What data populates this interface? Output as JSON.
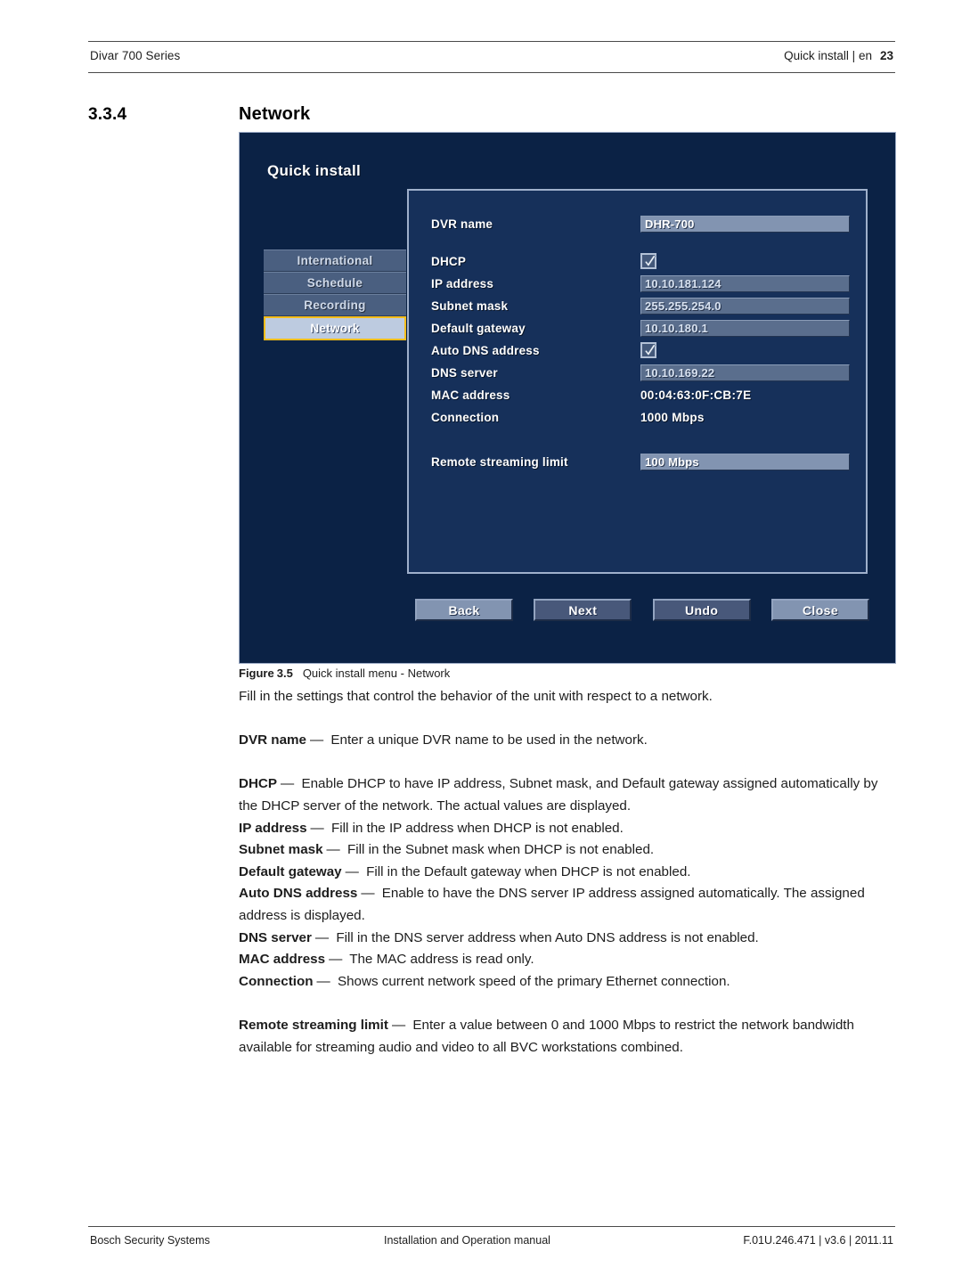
{
  "header": {
    "left": "Divar 700 Series",
    "right": "Quick install | en",
    "page_number": "23"
  },
  "section": {
    "number": "3.3.4",
    "title": "Network"
  },
  "screenshot": {
    "title": "Quick install",
    "nav": [
      {
        "label": "International",
        "selected": false
      },
      {
        "label": "Schedule",
        "selected": false
      },
      {
        "label": "Recording",
        "selected": false
      },
      {
        "label": "Network",
        "selected": true
      }
    ],
    "fields": [
      {
        "label": "DVR name",
        "value": "DHR-700",
        "type": "field-active"
      },
      {
        "label": "DHCP",
        "value": "checked",
        "type": "checkbox"
      },
      {
        "label": "IP address",
        "value": "10.10.181.124",
        "type": "field"
      },
      {
        "label": "Subnet mask",
        "value": "255.255.254.0",
        "type": "field"
      },
      {
        "label": "Default gateway",
        "value": "10.10.180.1",
        "type": "field"
      },
      {
        "label": "Auto DNS address",
        "value": "checked",
        "type": "checkbox"
      },
      {
        "label": "DNS server",
        "value": "10.10.169.22",
        "type": "field"
      },
      {
        "label": "MAC address",
        "value": "00:04:63:0F:CB:7E",
        "type": "text"
      },
      {
        "label": "Connection",
        "value": "1000 Mbps",
        "type": "text"
      },
      {
        "label": "Remote streaming limit",
        "value": "100 Mbps",
        "type": "field-active"
      }
    ],
    "buttons": [
      {
        "label": "Back",
        "style": "light"
      },
      {
        "label": "Next",
        "style": "dark"
      },
      {
        "label": "Undo",
        "style": "dark"
      },
      {
        "label": "Close",
        "style": "light"
      }
    ],
    "colors": {
      "panel_background": "#0b2245",
      "inner_panel_background": "#16305a",
      "selection_highlight": "#f5bd1a",
      "field_background": "#5a6e8d",
      "field_active_background": "#8294b1"
    }
  },
  "figure": {
    "label": "Figure",
    "number": "3.5",
    "caption": "Quick install menu - Network"
  },
  "body": {
    "intro": "Fill in the settings that control the behavior of the unit with respect to a network.",
    "items": [
      {
        "term": "DVR name",
        "dash": "—",
        "text": "Enter a unique DVR name to be used in the network."
      },
      {
        "term": "DHCP",
        "dash": "—",
        "text": "Enable DHCP to have IP address, Subnet mask, and Default gateway assigned automatically by the DHCP server of the network. The actual values are displayed."
      },
      {
        "term": "IP address",
        "dash": "—",
        "text": "Fill in the IP address when DHCP is not enabled."
      },
      {
        "term": "Subnet mask",
        "dash": "—",
        "text": "Fill in the Subnet mask when DHCP is not enabled."
      },
      {
        "term": "Default gateway",
        "dash": "—",
        "text": "Fill in the Default gateway when DHCP is not enabled."
      },
      {
        "term": "Auto DNS address",
        "dash": "—",
        "text": "Enable to have the DNS server IP address assigned automatically. The assigned address is displayed."
      },
      {
        "term": "DNS server",
        "dash": "—",
        "text": "Fill in the DNS server address when Auto DNS address is not enabled."
      },
      {
        "term": "MAC address",
        "dash": "—",
        "text": "The MAC address is read only."
      },
      {
        "term": "Connection",
        "dash": "—",
        "text": "Shows current network speed of the primary Ethernet connection."
      },
      {
        "term": "Remote streaming limit",
        "dash": "—",
        "text": "Enter a value between 0 and 1000 Mbps to restrict the network bandwidth available for streaming audio and video to all BVC workstations combined."
      }
    ]
  },
  "footer": {
    "left": "Bosch Security Systems",
    "center": "Installation and Operation manual",
    "right": "F.01U.246.471 | v3.6 | 2011.11"
  }
}
